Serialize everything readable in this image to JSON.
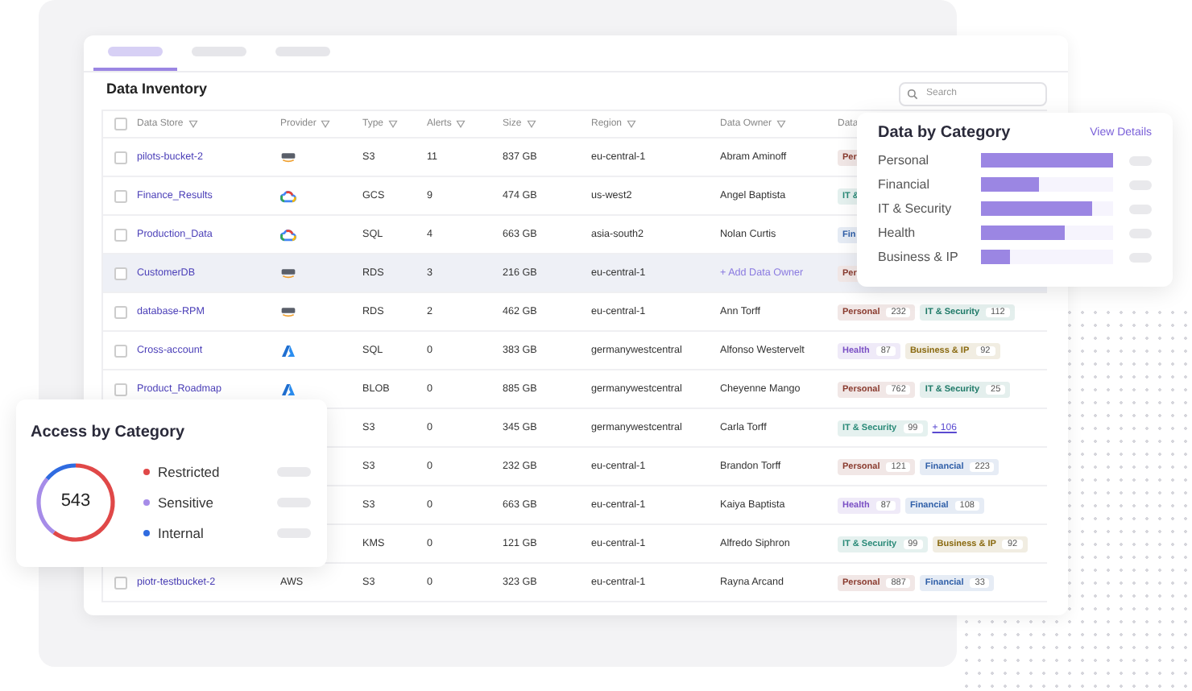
{
  "tabs": [
    {
      "selected": true
    },
    {
      "selected": false
    },
    {
      "selected": false
    }
  ],
  "inventory": {
    "title": "Data Inventory",
    "search": {
      "placeholder": "Search"
    },
    "columns": [
      {
        "label": "Data Store"
      },
      {
        "label": "Provider"
      },
      {
        "label": "Type"
      },
      {
        "label": "Alerts"
      },
      {
        "label": "Size"
      },
      {
        "label": "Region"
      },
      {
        "label": "Data Owner"
      },
      {
        "label": "Data"
      }
    ],
    "header_checked": false,
    "rows": [
      {
        "checked": false,
        "highlighted": false,
        "data_store": "pilots-bucket-2",
        "provider": {
          "kind": "aws"
        },
        "type": "S3",
        "alerts": "11",
        "size": "837 GB",
        "region": "eu-central-1",
        "owner": {
          "kind": "name",
          "text": "Abram Aminoff"
        },
        "tags": [
          {
            "label": "Per",
            "color": "#8a3b2f"
          }
        ]
      },
      {
        "checked": false,
        "highlighted": false,
        "data_store": "Finance_Results",
        "provider": {
          "kind": "gcp"
        },
        "type": "GCS",
        "alerts": "9",
        "size": "474 GB",
        "region": "us-west2",
        "owner": {
          "kind": "name",
          "text": "Angel Baptista"
        },
        "tags": [
          {
            "label": "IT &",
            "color": "#2a8a78"
          }
        ]
      },
      {
        "checked": false,
        "highlighted": false,
        "data_store": "Production_Data",
        "provider": {
          "kind": "gcp"
        },
        "type": "SQL",
        "alerts": "4",
        "size": "663 GB",
        "region": "asia-south2",
        "owner": {
          "kind": "name",
          "text": "Nolan Curtis"
        },
        "tags": [
          {
            "label": "Fin",
            "color": "#2f5fa8"
          }
        ]
      },
      {
        "checked": false,
        "highlighted": true,
        "data_store": "CustomerDB",
        "provider": {
          "kind": "aws"
        },
        "type": "RDS",
        "alerts": "3",
        "size": "216 GB",
        "region": "eu-central-1",
        "owner": {
          "kind": "link",
          "text": "+ Add Data Owner"
        },
        "tags": [
          {
            "label": "Per",
            "color": "#8a3b2f"
          }
        ]
      },
      {
        "checked": false,
        "highlighted": false,
        "data_store": "database-RPM",
        "provider": {
          "kind": "aws"
        },
        "type": "RDS",
        "alerts": "2",
        "size": "462 GB",
        "region": "eu-central-1",
        "owner": {
          "kind": "name",
          "text": "Ann Torff"
        },
        "tags": [
          {
            "label": "Personal",
            "count": "232",
            "color": "#8a3b2f"
          },
          {
            "label": "IT & Security",
            "count": "112",
            "color": "#1f7a68"
          }
        ]
      },
      {
        "checked": false,
        "highlighted": false,
        "data_store": "Cross-account",
        "provider": {
          "kind": "azure"
        },
        "type": "SQL",
        "alerts": "0",
        "size": "383 GB",
        "region": "germanywestcentral",
        "owner": {
          "kind": "name",
          "text": "Alfonso Westervelt"
        },
        "tags": [
          {
            "label": "Health",
            "count": "87",
            "color": "#7a4fc4"
          },
          {
            "label": "Business & IP",
            "count": "92",
            "color": "#8a6a10"
          }
        ]
      },
      {
        "checked": false,
        "highlighted": false,
        "data_store": "Product_Roadmap",
        "provider": {
          "kind": "azure"
        },
        "type": "BLOB",
        "alerts": "0",
        "size": "885 GB",
        "region": "germanywestcentral",
        "owner": {
          "kind": "name",
          "text": "Cheyenne Mango"
        },
        "tags": [
          {
            "label": "Personal",
            "count": "762",
            "color": "#8a3b2f"
          },
          {
            "label": "IT & Security",
            "count": "25",
            "color": "#1f7a68"
          }
        ]
      },
      {
        "type": "S3",
        "alerts": "0",
        "size": "345 GB",
        "region": "germanywestcentral",
        "owner": {
          "kind": "name",
          "text": "Carla Torff"
        },
        "tags": [
          {
            "label": "IT & Security",
            "count": "99",
            "color": "#2a8a78"
          }
        ],
        "more": "+ 106"
      },
      {
        "type": "S3",
        "alerts": "0",
        "size": "232 GB",
        "region": "eu-central-1",
        "owner": {
          "kind": "name",
          "text": "Brandon Torff"
        },
        "tags": [
          {
            "label": "Personal",
            "count": "121",
            "color": "#8a3b2f"
          },
          {
            "label": "Financial",
            "count": "223",
            "color": "#2f5fa8"
          }
        ]
      },
      {
        "type": "S3",
        "alerts": "0",
        "size": "663 GB",
        "region": "eu-central-1",
        "owner": {
          "kind": "name",
          "text": "Kaiya Baptista"
        },
        "tags": [
          {
            "label": "Health",
            "count": "87",
            "color": "#7a4fc4"
          },
          {
            "label": "Financial",
            "count": "108",
            "color": "#2f5fa8"
          }
        ]
      },
      {
        "type": "KMS",
        "alerts": "0",
        "size": "121 GB",
        "region": "eu-central-1",
        "owner": {
          "kind": "name",
          "text": "Alfredo Siphron"
        },
        "tags": [
          {
            "label": "IT & Security",
            "count": "99",
            "color": "#2a8a78"
          },
          {
            "label": "Business & IP",
            "count": "92",
            "color": "#8a6a10"
          }
        ]
      },
      {
        "checked": false,
        "highlighted": false,
        "data_store": "piotr-testbucket-2",
        "provider": {
          "kind": "text",
          "text": "AWS"
        },
        "type": "S3",
        "alerts": "0",
        "size": "323 GB",
        "region": "eu-central-1",
        "owner": {
          "kind": "name",
          "text": "Rayna  Arcand"
        },
        "tags": [
          {
            "label": "Personal",
            "count": "887",
            "color": "#8a3b2f"
          },
          {
            "label": "Financial",
            "count": "33",
            "color": "#2f5fa8"
          }
        ]
      }
    ]
  },
  "data_by_category": {
    "title": "Data by Category",
    "link": "View Details",
    "items": [
      {
        "label": "Personal",
        "level": 1.0
      },
      {
        "label": "Financial",
        "level": 0.44
      },
      {
        "label": "IT & Security",
        "level": 0.84
      },
      {
        "label": "Health",
        "level": 0.64
      },
      {
        "label": "Business & IP",
        "level": 0.22
      }
    ]
  },
  "access_by_category": {
    "title": "Access by Category",
    "total": "543",
    "items": [
      {
        "label": "Restricted",
        "color": "#e04848"
      },
      {
        "label": "Sensitive",
        "color": "#a68ce8"
      },
      {
        "label": "Internal",
        "color": "#2f6be0"
      }
    ]
  }
}
